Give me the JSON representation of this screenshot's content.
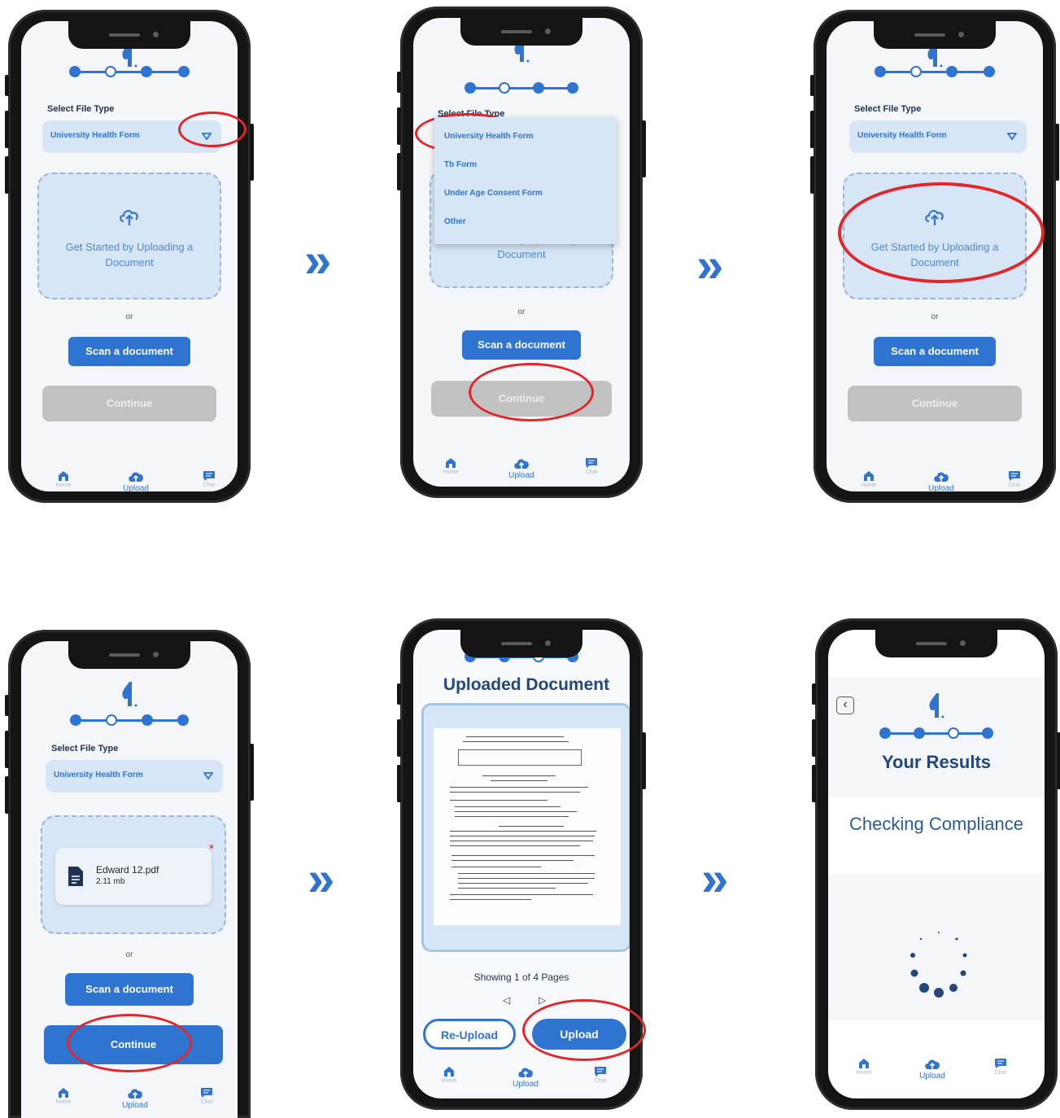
{
  "colors": {
    "accent": "#2f74d0",
    "highlight_ring": "#e3262a",
    "panel": "#d7e6f6",
    "disabled": "#c2c2c2",
    "title": "#23477c"
  },
  "common": {
    "select_label": "Select File Type",
    "selected_type": "University Health Form",
    "upload_prompt": "Get Started by Uploading a Document",
    "or": "or",
    "scan_button": "Scan a document",
    "continue_button": "Continue",
    "nav": {
      "home": "Home",
      "upload": "Upload",
      "chat": "Chat"
    },
    "icons": [
      "logo-icon",
      "chevron-down-icon",
      "cloud-upload-icon",
      "home-icon",
      "chat-icon",
      "double-chevron-right-icon",
      "pdf-file-icon",
      "back-arrow-icon"
    ]
  },
  "dropdown_options": [
    "University Health Form",
    "Tb Form",
    "Under Age Consent Form",
    "Other"
  ],
  "screen4": {
    "file_name": "Edward 12.pdf",
    "file_size": "2.11 mb",
    "remove": "×"
  },
  "screen5": {
    "title": "Uploaded Document",
    "page_info": "Showing 1 of 4 Pages",
    "prev": "◁",
    "next": "▷",
    "reupload_button": "Re-Upload",
    "upload_button": "Upload"
  },
  "screen6": {
    "title": "Your Results",
    "status": "Checking Compliance",
    "back": "‹"
  },
  "flow_arrow": "»"
}
